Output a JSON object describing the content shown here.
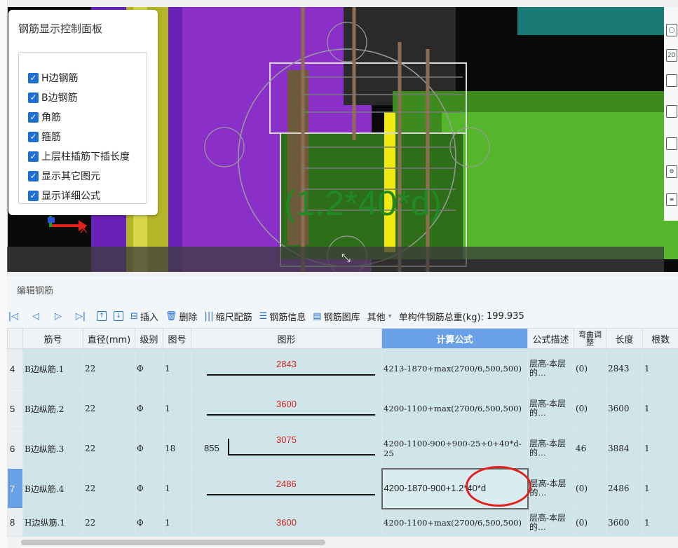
{
  "panel": {
    "title": "钢筋显示控制面板",
    "checkboxes": [
      {
        "label": "H边钢筋",
        "checked": true
      },
      {
        "label": "B边钢筋",
        "checked": true
      },
      {
        "label": "角筋",
        "checked": true
      },
      {
        "label": "箍筋",
        "checked": true
      },
      {
        "label": "上层柱插筋下插长度",
        "checked": true
      },
      {
        "label": "显示其它图元",
        "checked": true
      },
      {
        "label": "显示详细公式",
        "checked": true
      }
    ]
  },
  "viewport": {
    "overlay_formula": "(1.2*40*d)",
    "axis_label": "X"
  },
  "editor": {
    "title": "编辑钢筋",
    "toolbar": {
      "insert": "插入",
      "delete": "删除",
      "scale_bar": "缩尺配筋",
      "rebar_info": "钢筋信息",
      "rebar_library": "钢筋图库",
      "other": "其他",
      "total_weight_label": "单构件钢筋总重(kg):",
      "total_weight_value": "199.935"
    },
    "columns": [
      "筋号",
      "直径(mm)",
      "级别",
      "图号",
      "图形",
      "计算公式",
      "公式描述",
      "弯曲调整",
      "长度",
      "根数"
    ],
    "rows": [
      {
        "no": "4",
        "name": "B边纵筋.1",
        "diameter": "22",
        "grade": "Φ",
        "fig": "1",
        "shape_value": "2843",
        "shape_left": "",
        "formula": "4213-1870+max(2700/6,500,500)",
        "desc": "层高-本层的…",
        "bend": "(0)",
        "length": "2843",
        "count": "1"
      },
      {
        "no": "5",
        "name": "B边纵筋.2",
        "diameter": "22",
        "grade": "Φ",
        "fig": "1",
        "shape_value": "3600",
        "shape_left": "",
        "formula": "4200-1100+max(2700/6,500,500)",
        "desc": "层高-本层的…",
        "bend": "(0)",
        "length": "3600",
        "count": "1"
      },
      {
        "no": "6",
        "name": "B边纵筋.3",
        "diameter": "22",
        "grade": "Φ",
        "fig": "18",
        "shape_value": "3075",
        "shape_left": "855",
        "formula": "4200-1100-900+900-25+0+40*d-25",
        "desc": "层高-本层的…",
        "bend": "46",
        "length": "3884",
        "count": "1"
      },
      {
        "no": "7",
        "name": "B边纵筋.4",
        "diameter": "22",
        "grade": "Φ",
        "fig": "1",
        "shape_value": "2486",
        "shape_left": "",
        "formula": "4200-1870-900+1.2*40*d",
        "desc": "层高-本层的…",
        "bend": "(0)",
        "length": "2486",
        "count": "1"
      },
      {
        "no": "8",
        "name": "H边纵筋.1",
        "diameter": "22",
        "grade": "Φ",
        "fig": "1",
        "shape_value": "3600",
        "shape_left": "",
        "formula": "4200-1100+max(2700/6,500,500)",
        "desc": "层高-本层的…",
        "bend": "(0)",
        "length": "3600",
        "count": "1"
      }
    ]
  }
}
